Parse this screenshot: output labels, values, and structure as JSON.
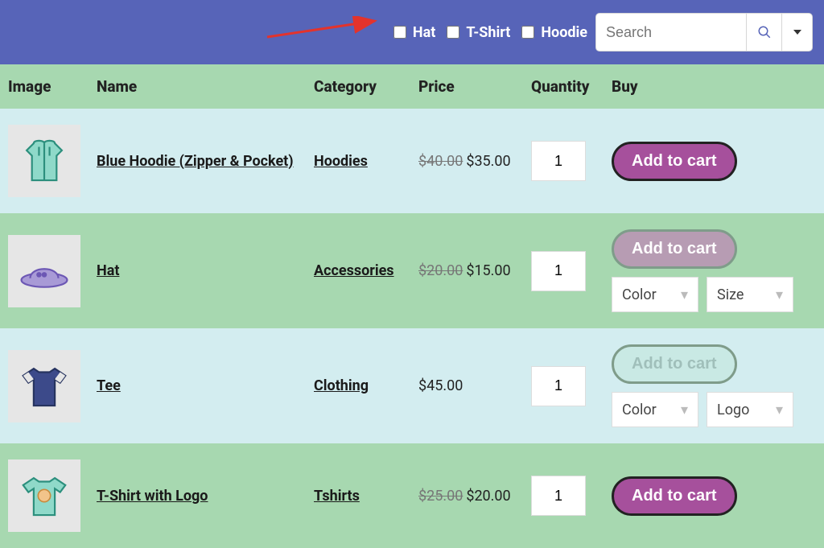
{
  "header": {
    "filters": [
      {
        "label": "Hat"
      },
      {
        "label": "T-Shirt"
      },
      {
        "label": "Hoodie"
      }
    ],
    "search_placeholder": "Search"
  },
  "table": {
    "headers": {
      "image": "Image",
      "name": "Name",
      "category": "Category",
      "price": "Price",
      "quantity": "Quantity",
      "buy": "Buy"
    }
  },
  "labels": {
    "add_to_cart": "Add to cart",
    "color": "Color",
    "size": "Size",
    "logo": "Logo"
  },
  "products": [
    {
      "name": "Blue Hoodie (Zipper & Pocket)",
      "category": "Hoodies",
      "old_price": "$40.00",
      "price": "$35.00",
      "qty": "1"
    },
    {
      "name": "Hat",
      "category": "Accessories",
      "old_price": "$20.00",
      "price": "$15.00",
      "qty": "1"
    },
    {
      "name": "Tee",
      "category": "Clothing",
      "old_price": "",
      "price": "$45.00",
      "qty": "1"
    },
    {
      "name": "T-Shirt with Logo",
      "category": "Tshirts",
      "old_price": "$25.00",
      "price": "$20.00",
      "qty": "1"
    }
  ]
}
